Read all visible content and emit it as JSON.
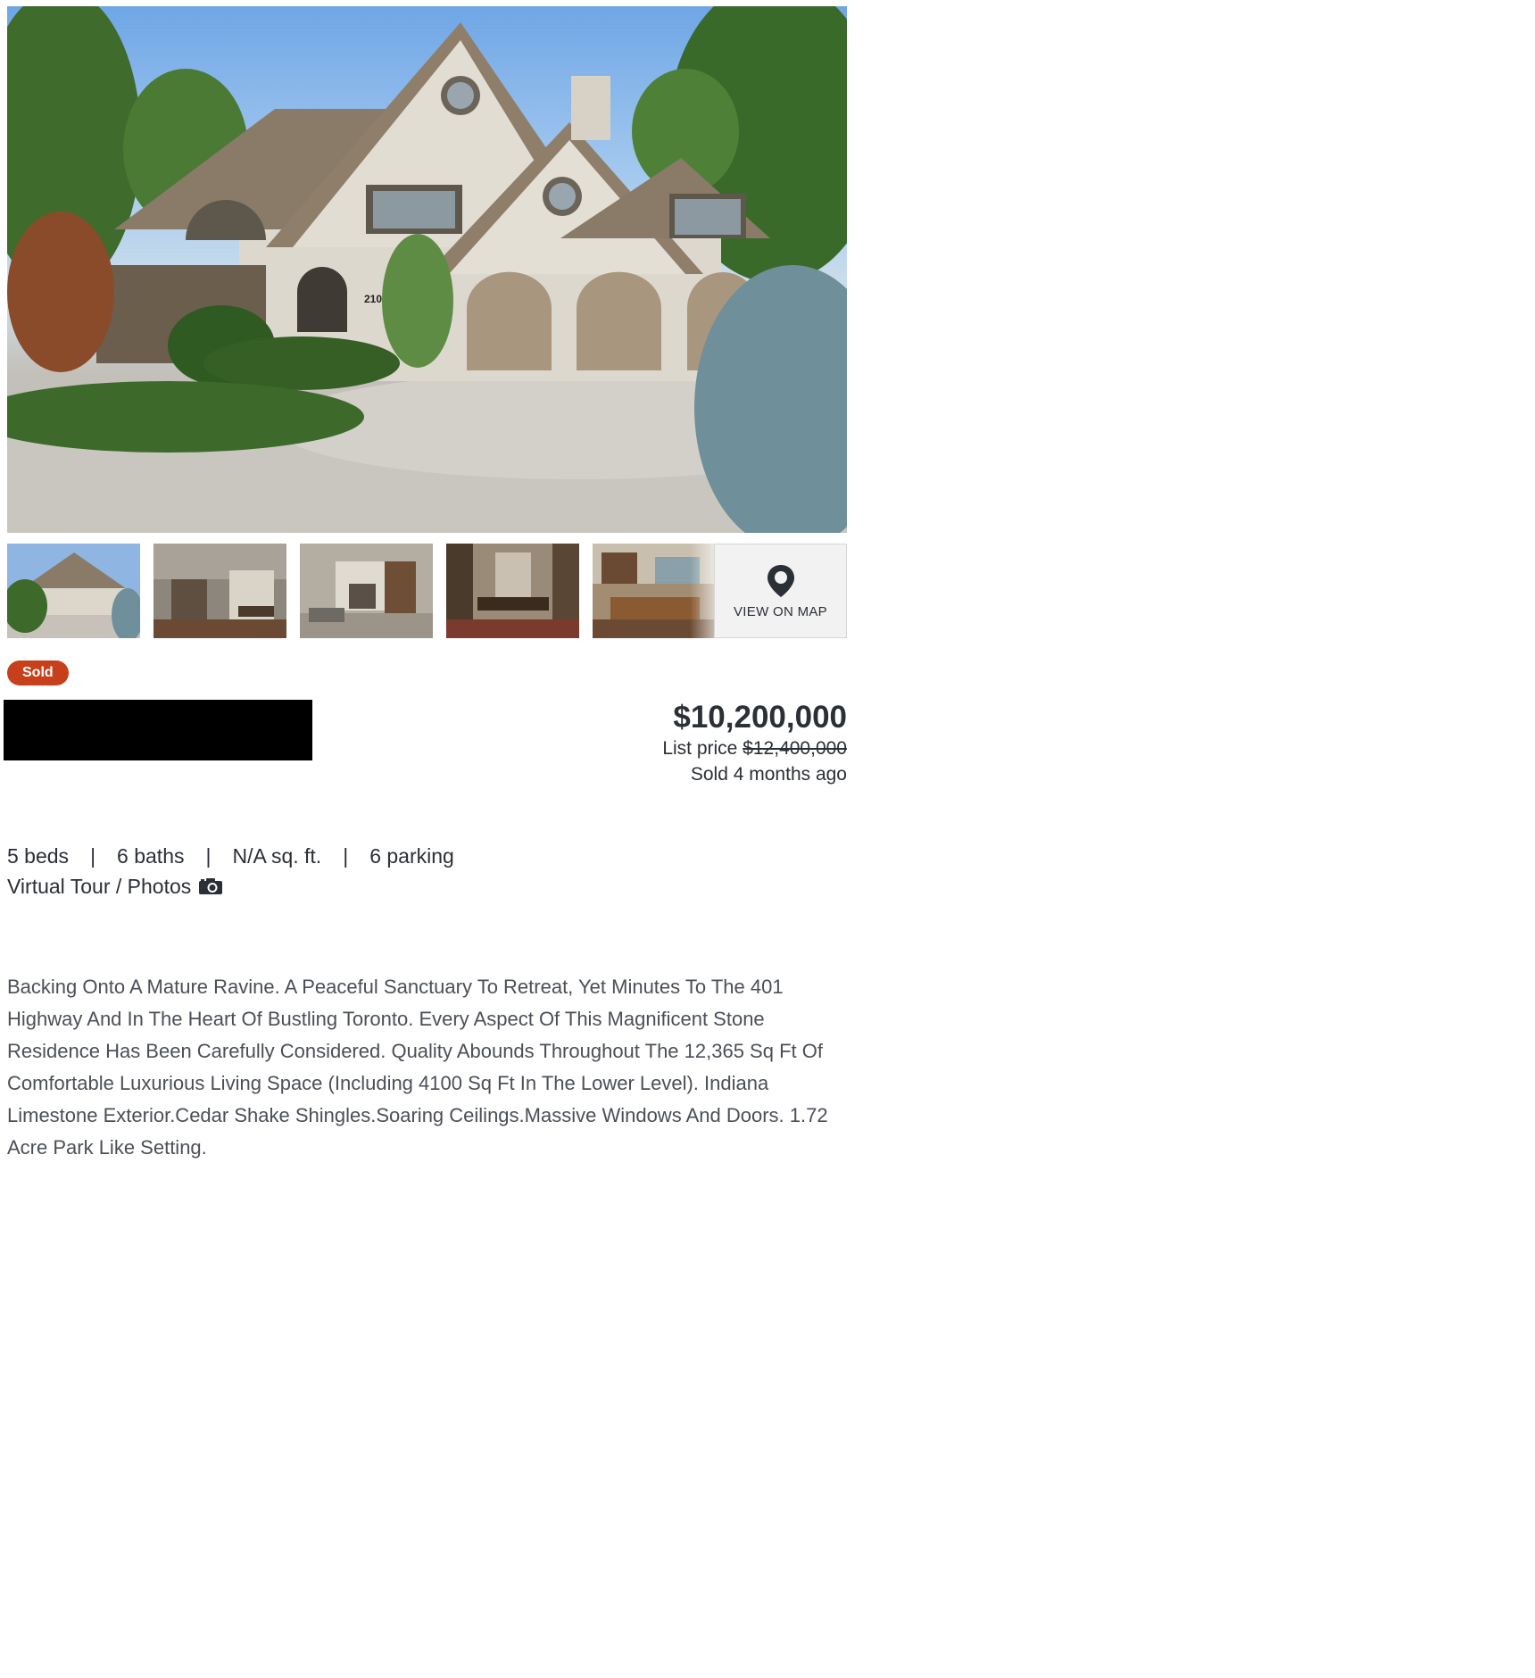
{
  "status_badge": "Sold",
  "price": "$10,200,000",
  "list_price_label": "List price",
  "list_price_original": "$12,400,000",
  "sold_time": "Sold 4 months ago",
  "facts": {
    "beds": "5 beds",
    "baths": "6 baths",
    "sqft": "N/A sq. ft.",
    "parking": "6 parking",
    "separator": "|"
  },
  "tour_label": "Virtual Tour / Photos",
  "map_button_label": "VIEW ON MAP",
  "house_number": "210",
  "description": "Backing Onto A Mature Ravine. A Peaceful Sanctuary To Retreat, Yet Minutes To The 401 Highway And In The Heart Of Bustling Toronto. Every Aspect Of This Magnificent Stone Residence Has Been Carefully Considered. Quality Abounds Throughout The 12,365 Sq Ft Of Comfortable Luxurious Living Space (Including 4100 Sq Ft In The Lower Level). Indiana Limestone Exterior.Cedar Shake Shingles.Soaring Ceilings.Massive Windows And Doors. 1.72 Acre Park Like Setting.",
  "colors": {
    "badge": "#c8401b",
    "text": "#2b2f36",
    "description": "#4b4f57"
  }
}
